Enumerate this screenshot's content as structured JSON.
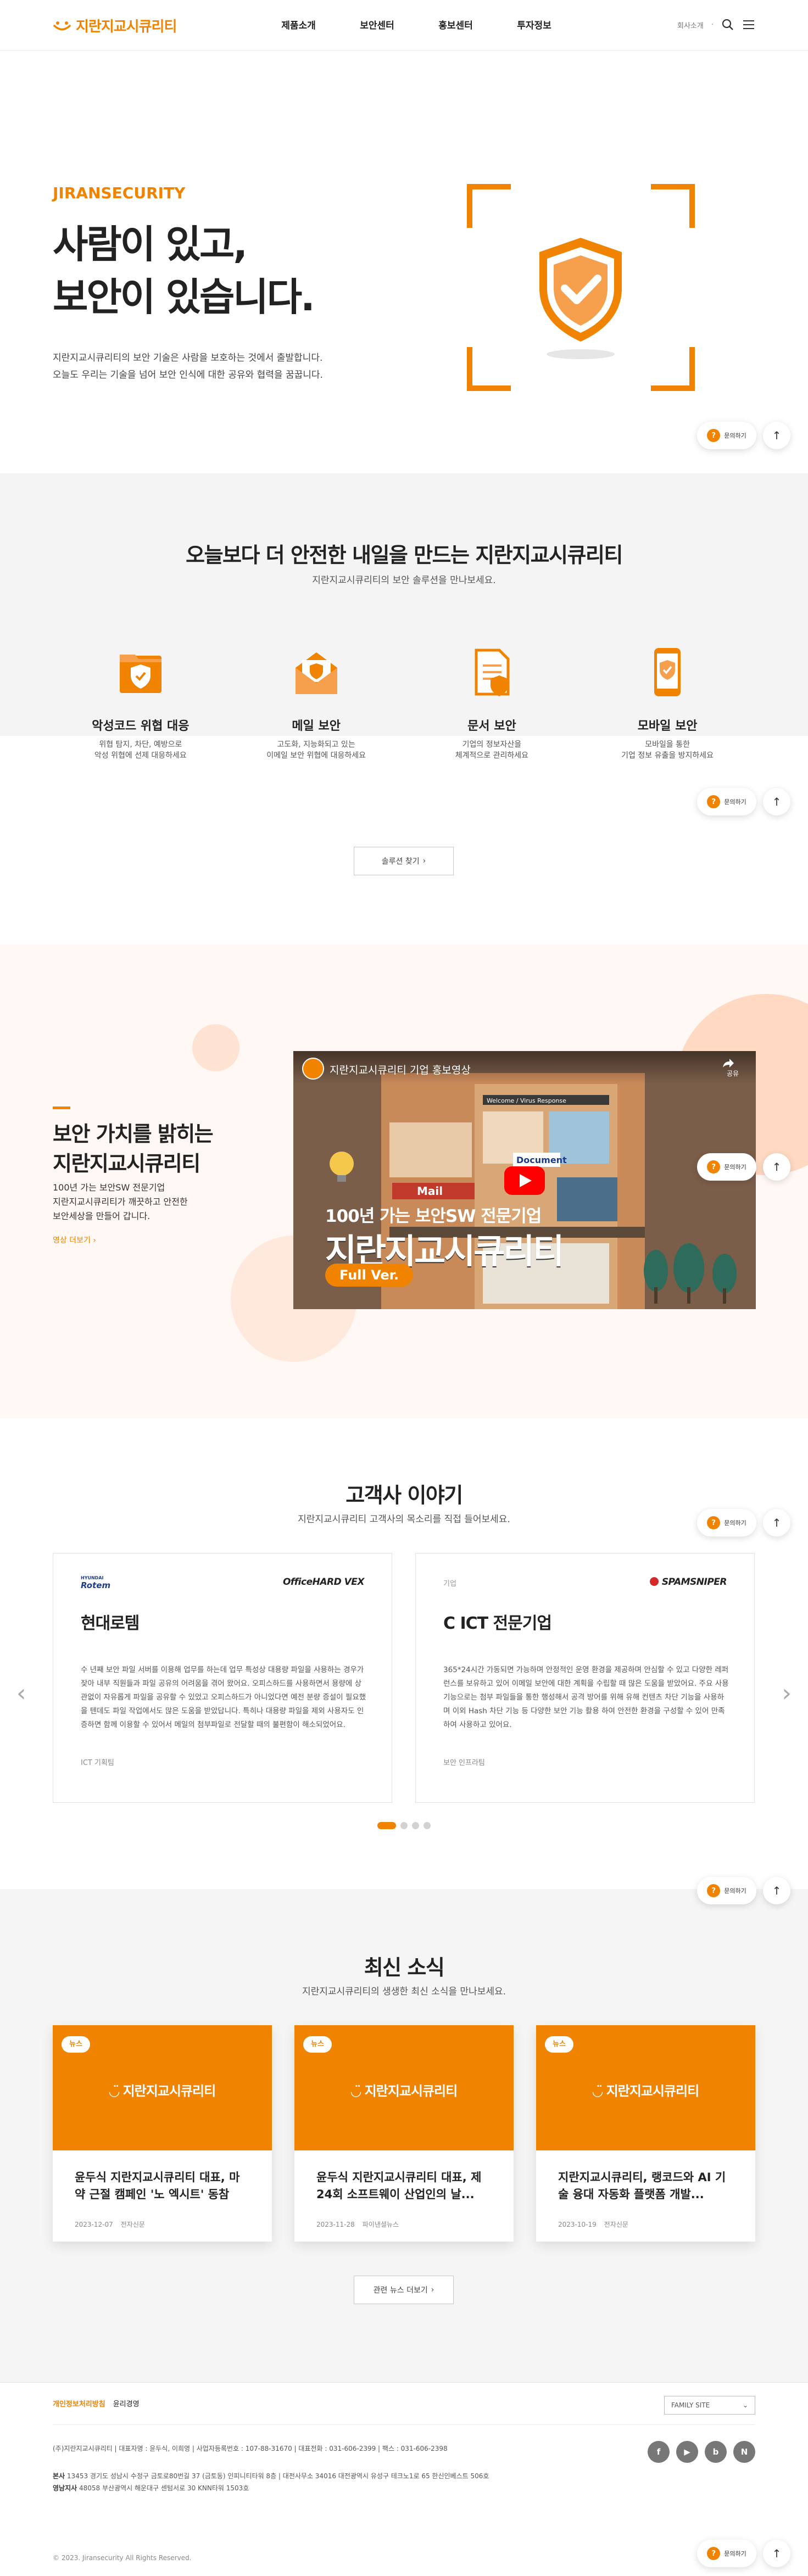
{
  "header": {
    "logo_text": "지란지교시큐리티",
    "nav": [
      "제품소개",
      "보안센터",
      "홍보센터",
      "투자정보"
    ],
    "lang": "회사소개",
    "lang_sep": "·"
  },
  "hero": {
    "eyebrow": "JIRANSECURITY",
    "title_line1": "사람이 있고,",
    "title_line2": "보안이 있습니다.",
    "desc_line1": "지란지교시큐리티의 보안 기술은 사람을 보호하는 것에서 출발합니다.",
    "desc_line2": "오늘도 우리는 기술을 넘어 보안 인식에 대한 공유와 협력을 꿈꿉니다."
  },
  "floating": {
    "ask_label": "문의하기",
    "ask_icon": "?",
    "top_icon": "↑"
  },
  "solutions": {
    "title": "오늘보다 더 안전한 내일을 만드는 지란지교시큐리티",
    "subtitle": "지란지교시큐리티의 보안 솔루션을 만나보세요.",
    "items": [
      {
        "name": "악성코드 위협 대응",
        "desc": "위협 탐지, 차단, 예방으로\n악성 위협에 선제 대응하세요",
        "icon": "folder-shield-icon"
      },
      {
        "name": "메일 보안",
        "desc": "고도화, 지능화되고 있는\n이메일 보안 위협에 대응하세요",
        "icon": "mail-shield-icon"
      },
      {
        "name": "문서 보안",
        "desc": "기업의 정보자산을\n체계적으로 관리하세요",
        "icon": "document-shield-icon"
      },
      {
        "name": "모바일 보안",
        "desc": "모바일을 통한\n기업 정보 유출을 방지하세요",
        "icon": "mobile-shield-icon"
      }
    ],
    "button": "솔루션 찾기",
    "button_arrow": "›"
  },
  "video": {
    "title_line1": "보안 가치를 밝히는",
    "title_line2": "지란지교시큐리티",
    "desc_line1": "100년 가는 보안SW 전문기업",
    "desc_line2": "지란지교시큐리티가 깨끗하고 안전한",
    "desc_line3": "보안세상을 만들어 갑니다.",
    "link": "영상 더보기 ›",
    "player_caption": "지란지교시큐리티 기업 홍보영상",
    "player_share": "공유",
    "player_text1": "100년 가는 보안SW 전문기업",
    "player_text2": "지란지교시큐리티",
    "player_text3": "Full Ver.",
    "player_document": "Document",
    "player_mail": "Mail",
    "player_sign": "Welcome / Virus Response"
  },
  "customers": {
    "title": "고객사 이야기",
    "subtitle": "지란지교시큐리티 고객사의 목소리를 직접 들어보세요.",
    "cards": [
      {
        "tag": "",
        "logo": "Rotem",
        "logo_small": "HYUNDAI",
        "brand": "OfficeHARD VEX",
        "name": "현대로템",
        "text": "수 년째 보안 파일 서버를 이용해 업무를 하는데 업무 특성상 대용량 파일을 사용하는 경우가 잦아 내부 직원들과 파일 공유의 어려움을 겪어 왔어요. 오피스하드를 사용하면서 용량에 상관없이 자유롭게 파일을 공유할 수 있었고 오피스하드가 아니었다면 예전 분량 증설이 필요했을 텐데도 파일 작업에서도 많은 도움을 받았답니다. 특히나 대용량 파일을 제외 사용자도 인증하면 함께 이용할 수 있어서 메일의 첨부파일로 전달할 때의 불편함이 해소되었어요.",
        "foot": "ICT 기획팀"
      },
      {
        "tag": "기업",
        "logo": "",
        "logo_small": "",
        "brand": "SPAMSNIPER",
        "name": "C ICT 전문기업",
        "text": "365*24시간 가동되면 가능하며 안정적인 운영 환경을 제공하며 안심할 수 있고 다양한 레퍼런스를 보유하고 있어 이메일 보안에 대한 계획을 수립할 때 많은 도움을 받았어요. 주요 사용 기능으로는 첨부 파일들을 통한 행성해서 공격 방어를 위해 유해 컨텐츠 차단 기능을 사용하며 이외 Hash 차단 기능 등 다양한 보안 기능 활용 하여 안전한 환경을 구성할 수 있어 만족하여 사용하고 있어요.",
        "foot": "보안 인프라팀"
      }
    ],
    "arrow_prev": "‹",
    "arrow_next": "›"
  },
  "news": {
    "title": "최신 소식",
    "subtitle": "지란지교시큐리티의 생생한 최신 소식을 만나보세요.",
    "cards": [
      {
        "badge": "뉴스",
        "logo": "지란지교시큐리티",
        "title": "윤두식 지란지교시큐리티 대표, 마약 근절 캠페인 '노 엑시트' 동참",
        "date": "2023-12-07",
        "source": "전자신문"
      },
      {
        "badge": "뉴스",
        "logo": "지란지교시큐리티",
        "title": "윤두식 지란지교시큐리티 대표, 제24회 소프트웨이 산업인의 날...",
        "date": "2023-11-28",
        "source": "파이낸셜뉴스"
      },
      {
        "badge": "뉴스",
        "logo": "지란지교시큐리티",
        "title": "지란지교시큐리티, 랭코드와 AI 기술 융대 자동화 플랫폼 개발...",
        "date": "2023-10-19",
        "source": "전자신문"
      }
    ],
    "button": "관련 뉴스 더보기",
    "button_arrow": "›"
  },
  "footer": {
    "privacy": "개인정보처리방침",
    "email_policy": "윤리경영",
    "family": "FAMILY SITE",
    "family_arrow": "⌄",
    "company_line": "(주)지란지교시큐리티 | 대표자명 : 윤두식, 이희영 | 사업자등록번호 : 107-88-31670 | 대표전화 : 031-606-2399 | 팩스 : 031-606-2398",
    "hq_label": "본사",
    "hq": "13453 경기도 성남시 수정구 금토로80번길 37 (금토동) 인피니티타워 8층  |  대전사무소 34016 대전광역시 유성구 테크노1로 65 한신인베스트 506호",
    "pusan_label": "영남지사",
    "pusan": "48058 부산광역시 해운대구 센텀서로 30 KNN타워 1503호",
    "sns": [
      "f",
      "▶",
      "b",
      "N"
    ],
    "copyright": "© 2023. Jiransecurity All Rights Reserved."
  },
  "colors": {
    "accent": "#f08300",
    "gray_bg": "#f4f4f4",
    "video_bg": "#fff8f4"
  }
}
